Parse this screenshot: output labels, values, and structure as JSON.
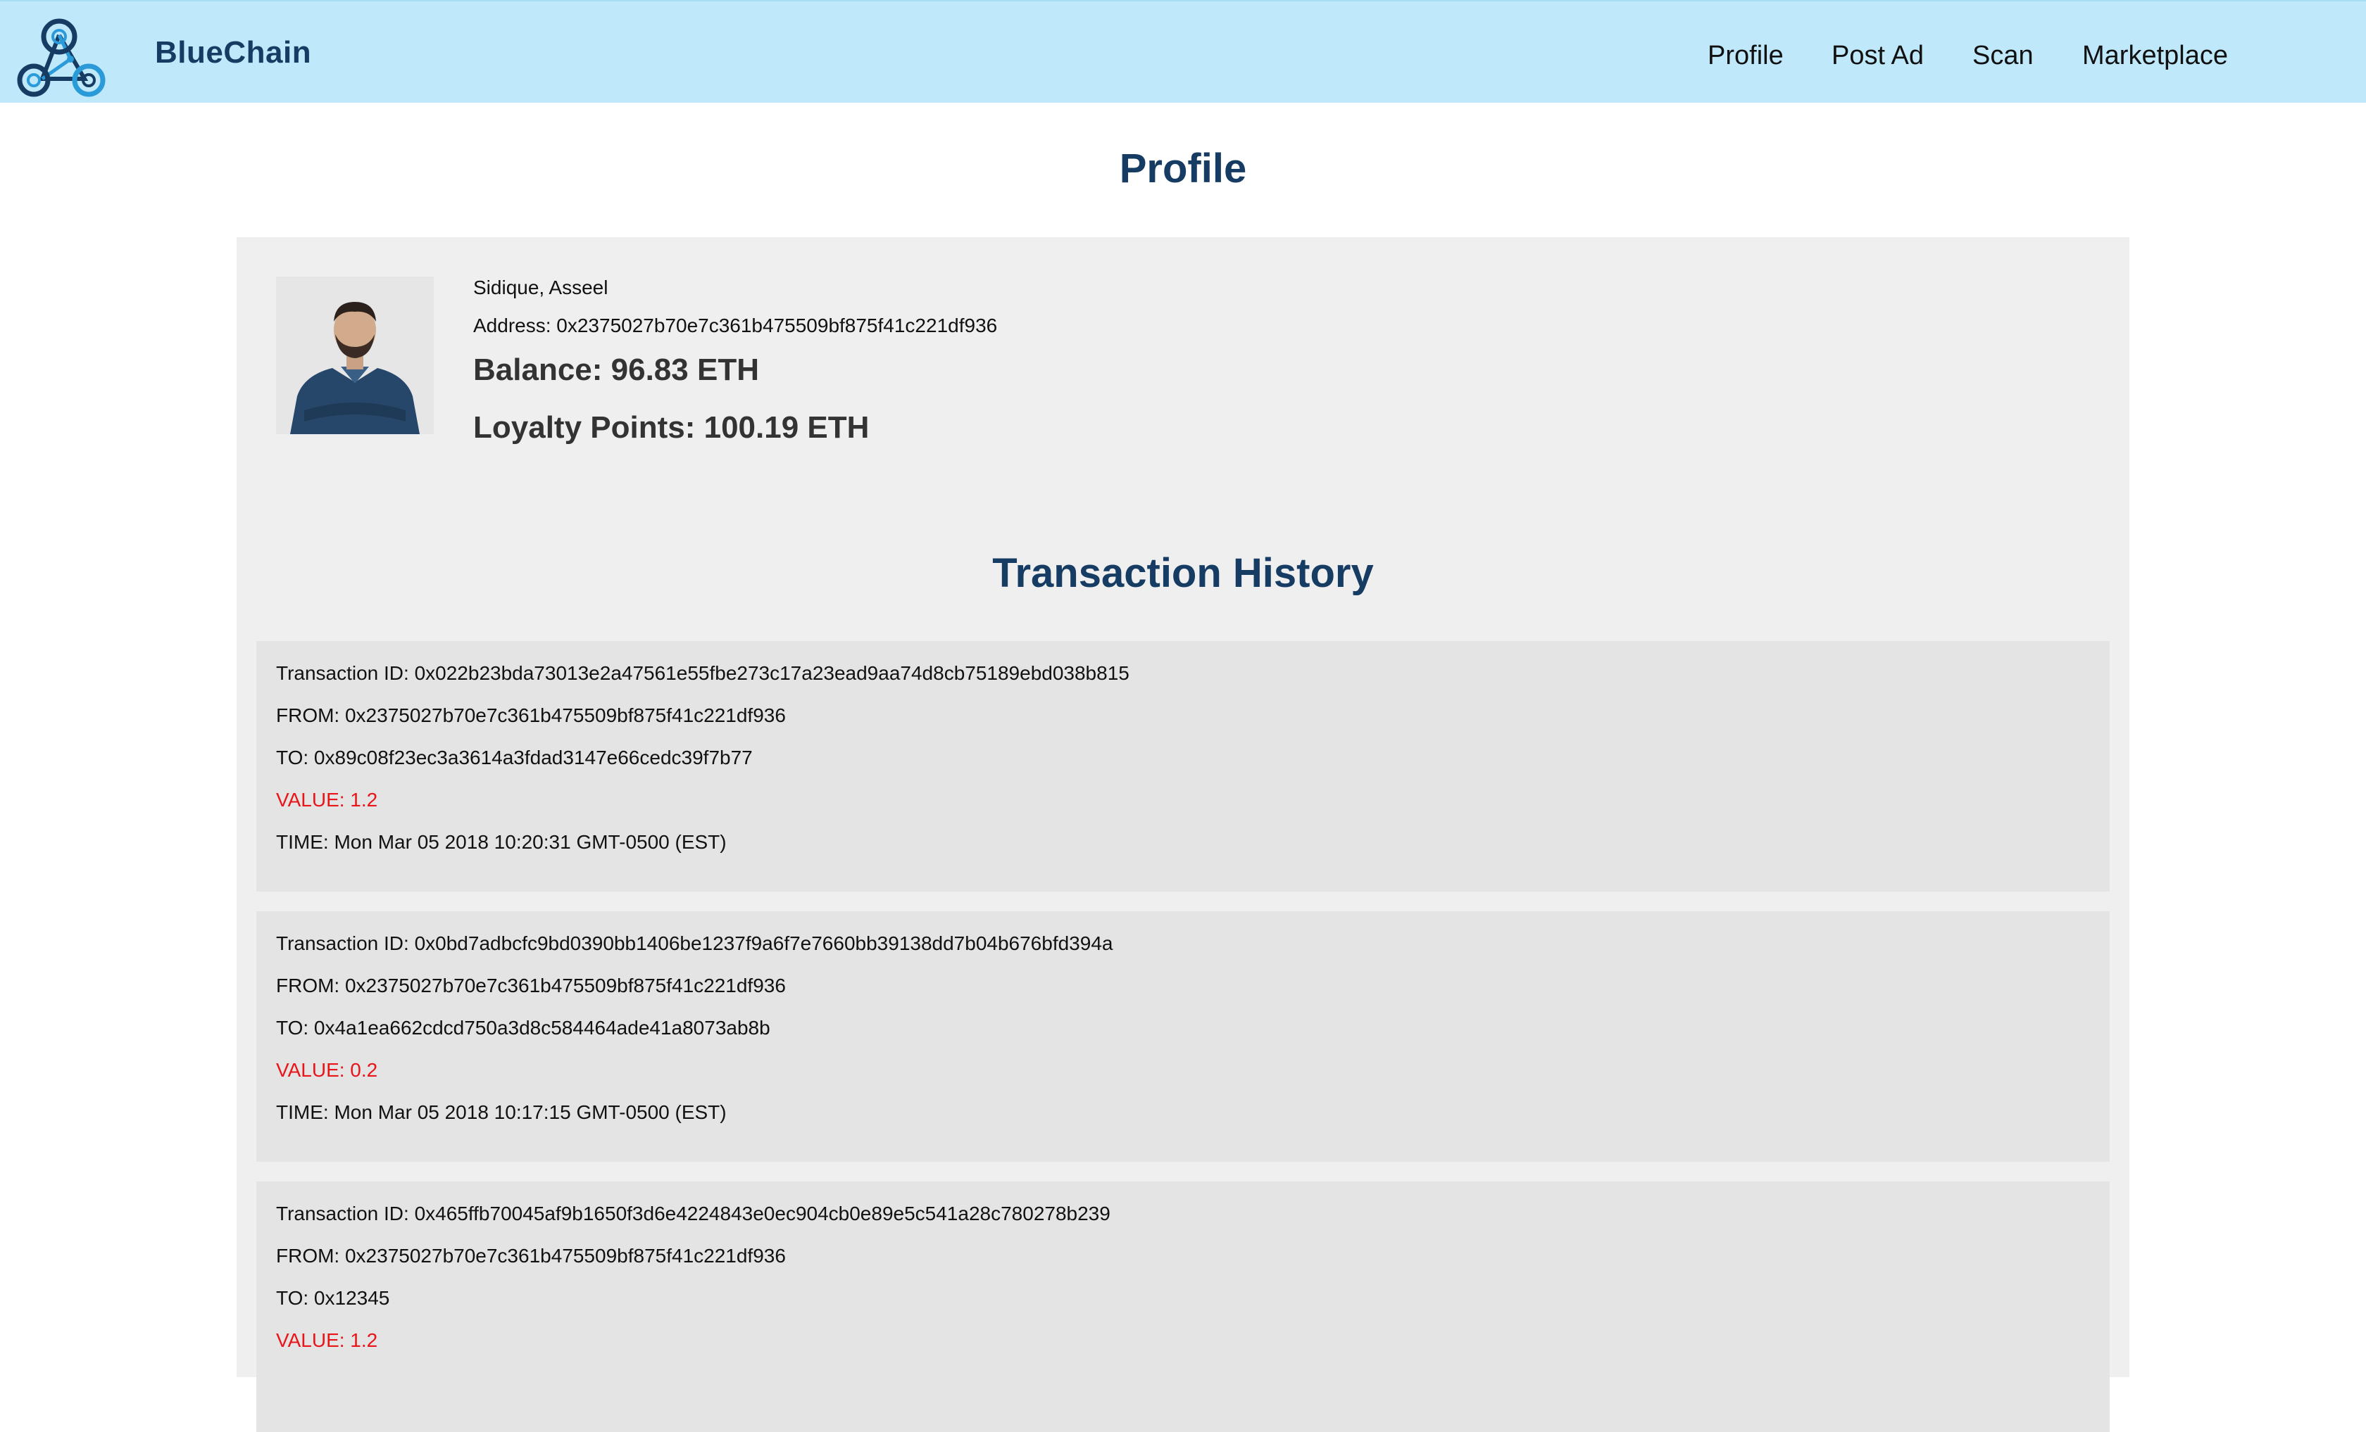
{
  "app": {
    "brand": "BlueChain"
  },
  "nav": {
    "items": [
      {
        "label": "Profile"
      },
      {
        "label": "Post Ad"
      },
      {
        "label": "Scan"
      },
      {
        "label": "Marketplace"
      }
    ]
  },
  "page": {
    "title": "Profile"
  },
  "profile": {
    "name": "Sidique, Asseel",
    "address": "Address: 0x2375027b70e7c361b475509bf875f41c221df936",
    "balance": "Balance: 96.83 ETH",
    "loyalty": "Loyalty Points: 100.19 ETH"
  },
  "history": {
    "title": "Transaction History",
    "transactions": [
      {
        "id": "Transaction ID: 0x022b23bda73013e2a47561e55fbe273c17a23ead9aa74d8cb75189ebd038b815",
        "from": "FROM: 0x2375027b70e7c361b475509bf875f41c221df936",
        "to": "TO: 0x89c08f23ec3a3614a3fdad3147e66cedc39f7b77",
        "value": "VALUE: 1.2",
        "time": "TIME: Mon Mar 05 2018 10:20:31 GMT-0500 (EST)"
      },
      {
        "id": "Transaction ID: 0x0bd7adbcfc9bd0390bb1406be1237f9a6f7e7660bb39138dd7b04b676bfd394a",
        "from": "FROM: 0x2375027b70e7c361b475509bf875f41c221df936",
        "to": "TO: 0x4a1ea662cdcd750a3d8c584464ade41a8073ab8b",
        "value": "VALUE: 0.2",
        "time": "TIME: Mon Mar 05 2018 10:17:15 GMT-0500 (EST)"
      },
      {
        "id": "Transaction ID: 0x465ffb70045af9b1650f3d6e4224843e0ec904cb0e89e5c541a28c780278b239",
        "from": "FROM: 0x2375027b70e7c361b475509bf875f41c221df936",
        "to": "TO: 0x12345",
        "value": "VALUE: 1.2",
        "time": ""
      }
    ]
  },
  "colors": {
    "navbar_bg": "#bfe8fb",
    "brand_text": "#173c63",
    "heading": "#173c63",
    "panel_bg": "#efefef",
    "card_bg": "#e4e4e4",
    "value_text": "#e8151b"
  },
  "icons": {
    "logo": "bluechain-logo-icon",
    "avatar": "user-avatar"
  }
}
